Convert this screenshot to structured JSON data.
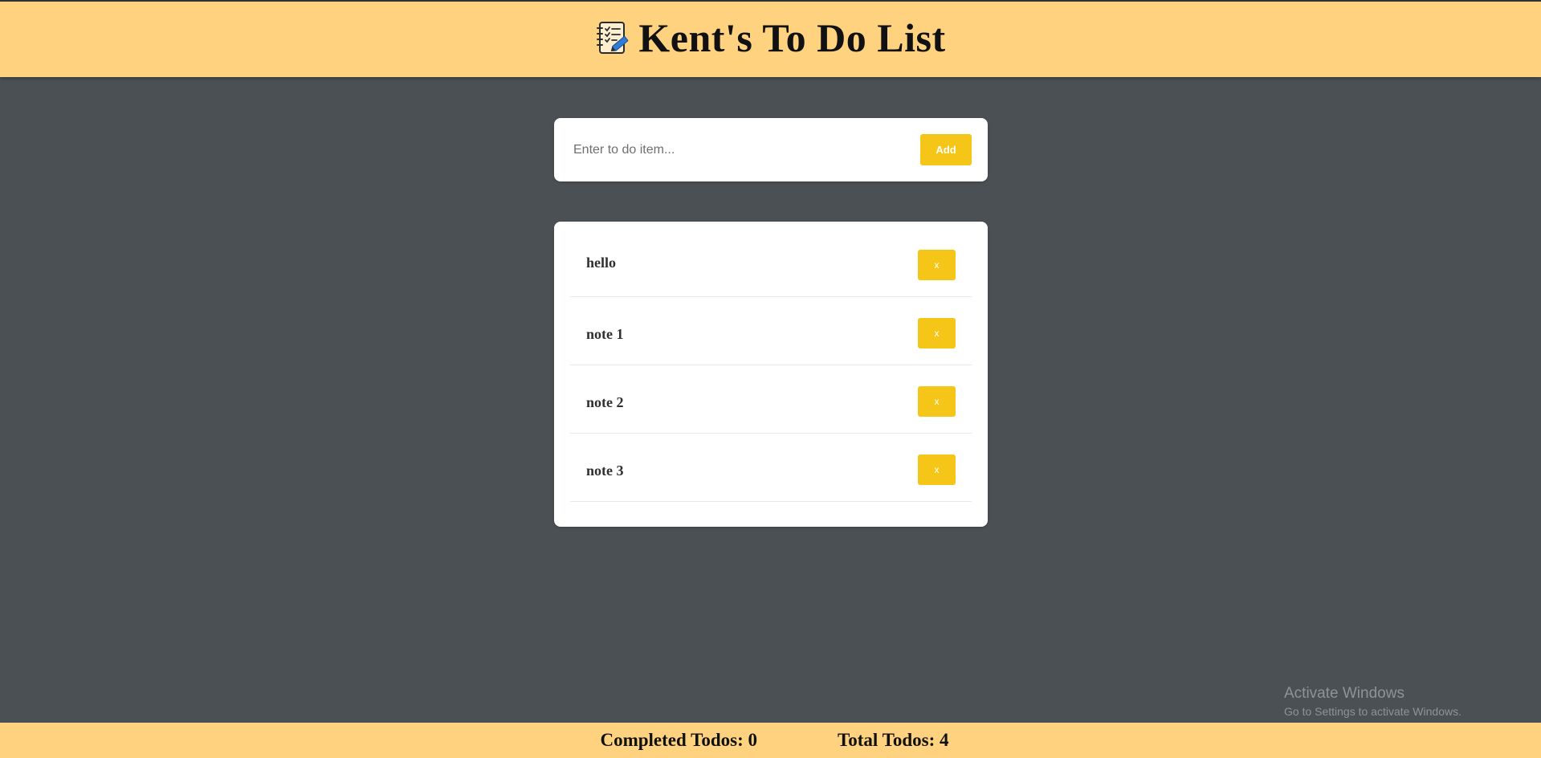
{
  "header": {
    "title": "Kent's To Do List",
    "icon": "notebook-checklist-icon"
  },
  "new_todo": {
    "placeholder": "Enter to do item...",
    "value": "",
    "add_label": "Add"
  },
  "todos": [
    {
      "text": "hello",
      "delete_label": "x"
    },
    {
      "text": "note 1",
      "delete_label": "x"
    },
    {
      "text": "note 2",
      "delete_label": "x"
    },
    {
      "text": "note 3",
      "delete_label": "x"
    }
  ],
  "footer": {
    "completed": "Completed Todos: 0",
    "total": "Total Todos: 4"
  },
  "watermark": {
    "title": "Activate Windows",
    "subtitle": "Go to Settings to activate Windows."
  },
  "colors": {
    "header_bg": "#fed27f",
    "page_bg": "#4a5053",
    "accent": "#f5c518",
    "card_bg": "#ffffff"
  }
}
